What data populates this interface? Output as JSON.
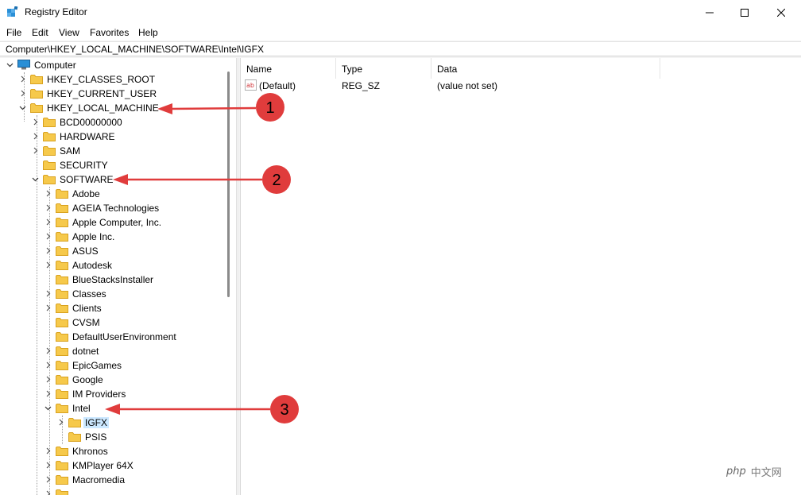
{
  "window": {
    "title": "Registry Editor",
    "controls": [
      "minimize",
      "maximize",
      "close"
    ]
  },
  "menu": [
    "File",
    "Edit",
    "View",
    "Favorites",
    "Help"
  ],
  "address": "Computer\\HKEY_LOCAL_MACHINE\\SOFTWARE\\Intel\\IGFX",
  "tree": {
    "root": "Computer",
    "items": [
      {
        "label": "HKEY_CLASSES_ROOT"
      },
      {
        "label": "HKEY_CURRENT_USER"
      },
      {
        "label": "HKEY_LOCAL_MACHINE"
      },
      {
        "label": "BCD00000000"
      },
      {
        "label": "HARDWARE"
      },
      {
        "label": "SAM"
      },
      {
        "label": "SECURITY"
      },
      {
        "label": "SOFTWARE"
      },
      {
        "label": "Adobe"
      },
      {
        "label": "AGEIA Technologies"
      },
      {
        "label": "Apple Computer, Inc."
      },
      {
        "label": "Apple Inc."
      },
      {
        "label": "ASUS"
      },
      {
        "label": "Autodesk"
      },
      {
        "label": "BlueStacksInstaller"
      },
      {
        "label": "Classes"
      },
      {
        "label": "Clients"
      },
      {
        "label": "CVSM"
      },
      {
        "label": "DefaultUserEnvironment"
      },
      {
        "label": "dotnet"
      },
      {
        "label": "EpicGames"
      },
      {
        "label": "Google"
      },
      {
        "label": "IM Providers"
      },
      {
        "label": "Intel"
      },
      {
        "label": "IGFX"
      },
      {
        "label": "PSIS"
      },
      {
        "label": "Khronos"
      },
      {
        "label": "KMPlayer 64X"
      },
      {
        "label": "Macromedia"
      }
    ],
    "selected": "IGFX"
  },
  "list": {
    "columns": [
      "Name",
      "Type",
      "Data"
    ],
    "rows": [
      {
        "name": "(Default)",
        "type": "REG_SZ",
        "data": "(value not set)",
        "icon": "ab-string-icon"
      }
    ]
  },
  "annotations": [
    "1",
    "2",
    "3"
  ],
  "watermark": {
    "logo": "php",
    "text": "中文网"
  },
  "colors": {
    "folder": "#f6c94b",
    "selection": "#cce8ff",
    "annotation": "#e03c3c",
    "computer_icon": "#2a8fd6"
  }
}
